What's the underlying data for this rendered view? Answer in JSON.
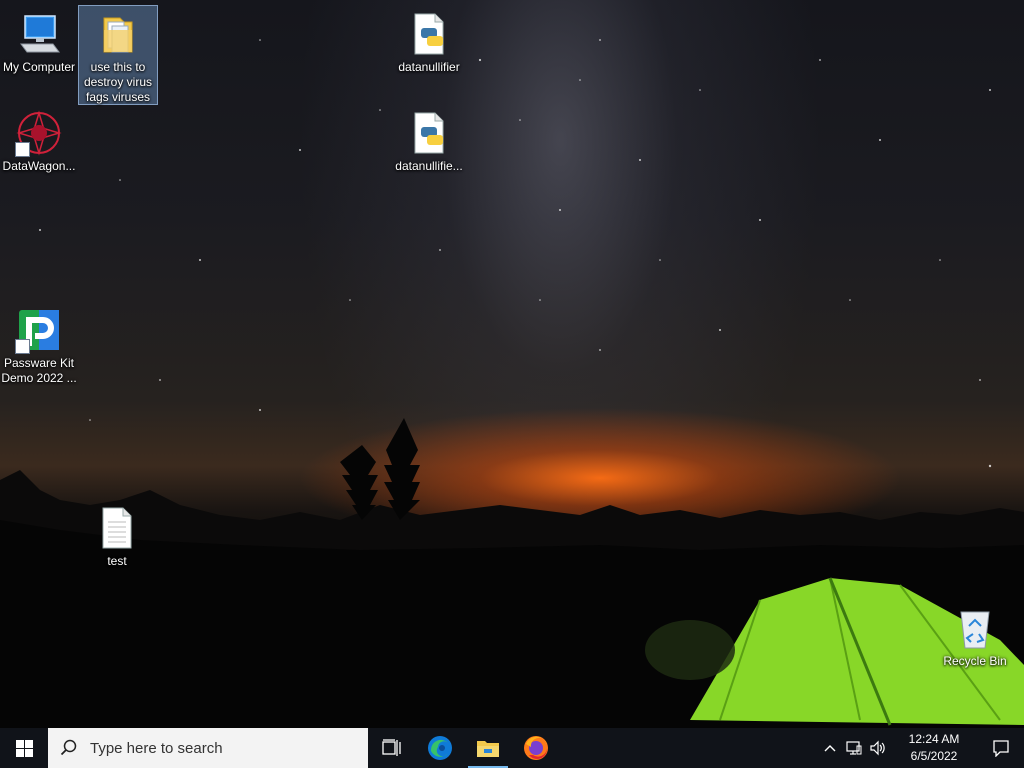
{
  "desktop": {
    "icons": [
      {
        "label": "My Computer",
        "type": "computer"
      },
      {
        "label": "use this to destroy virus fags viruses",
        "type": "folder",
        "selected": true
      },
      {
        "label": "datanullifier",
        "type": "python-file"
      },
      {
        "label": "DataWagon...",
        "type": "shortcut"
      },
      {
        "label": "datanullifie...",
        "type": "python-file"
      },
      {
        "label": "Passware Kit Demo 2022 ...",
        "type": "shortcut"
      },
      {
        "label": "test",
        "type": "text-file"
      },
      {
        "label": "Recycle Bin",
        "type": "recycle-bin"
      }
    ]
  },
  "taskbar": {
    "start_icon": "windows-logo-icon",
    "search_placeholder": "Type here to search",
    "pinned": [
      {
        "name": "task-view",
        "icon": "task-view-icon"
      },
      {
        "name": "edge",
        "icon": "edge-icon"
      },
      {
        "name": "file-explorer",
        "icon": "folder-icon",
        "active": true
      },
      {
        "name": "firefox",
        "icon": "firefox-icon"
      }
    ],
    "tray": {
      "time": "12:24 AM",
      "date": "6/5/2022"
    }
  },
  "colors": {
    "taskbar_bg": "#101319",
    "search_bg": "#f3f3f3",
    "active_indicator": "#76b9ed",
    "tent_green": "#8fe32a"
  }
}
